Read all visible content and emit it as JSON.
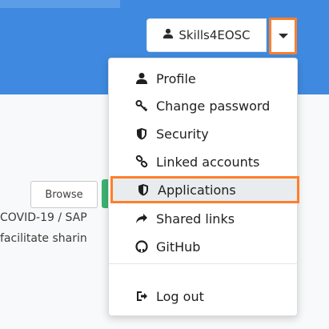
{
  "header": {
    "user_label": "Skills4EOSC",
    "accent_color": "#3f8ae0",
    "highlight_color": "#ff7f2a"
  },
  "page": {
    "browse_label": "Browse",
    "body_lines": [
      "COVID-19 / SAP",
      "facilitate sharin"
    ]
  },
  "menu": {
    "items": [
      {
        "label": "Profile",
        "icon": "user-icon"
      },
      {
        "label": "Change password",
        "icon": "key-icon"
      },
      {
        "label": "Security",
        "icon": "shield-icon"
      },
      {
        "label": "Linked accounts",
        "icon": "link-icon"
      },
      {
        "label": "Applications",
        "icon": "shield-icon"
      },
      {
        "label": "Shared links",
        "icon": "share-icon"
      },
      {
        "label": "GitHub",
        "icon": "github-icon"
      }
    ],
    "logout": {
      "label": "Log out",
      "icon": "sign-out-icon"
    }
  }
}
